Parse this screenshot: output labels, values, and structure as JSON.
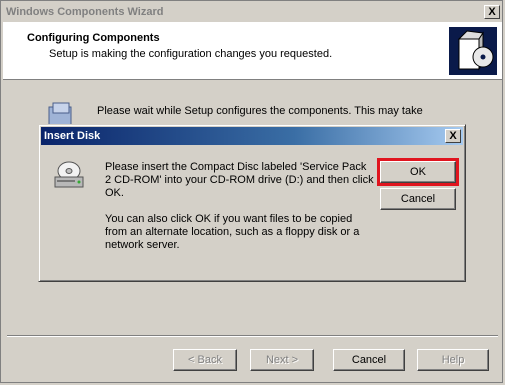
{
  "window": {
    "title": "Windows Components Wizard",
    "close_label": "X"
  },
  "header": {
    "title": "Configuring Components",
    "subtitle": "Setup is making the configuration changes you requested."
  },
  "body": {
    "text": "Please wait while Setup configures the components. This may take"
  },
  "footer": {
    "back_label": "< Back",
    "next_label": "Next >",
    "cancel_label": "Cancel",
    "help_label": "Help"
  },
  "dialog": {
    "title": "Insert Disk",
    "close_label": "X",
    "message_1": "Please insert the Compact Disc labeled 'Service Pack 2 CD-ROM' into your CD-ROM drive (D:) and then click OK.",
    "message_2": "You can also click OK if you want files to be copied from an alternate location, such as a floppy disk or a network server.",
    "ok_label": "OK",
    "cancel_label": "Cancel"
  },
  "colors": {
    "face": "#d4d0c8",
    "dialog_title_start": "#0a246a",
    "dialog_title_end": "#a6caf0",
    "highlight_outline": "#e0151f"
  }
}
